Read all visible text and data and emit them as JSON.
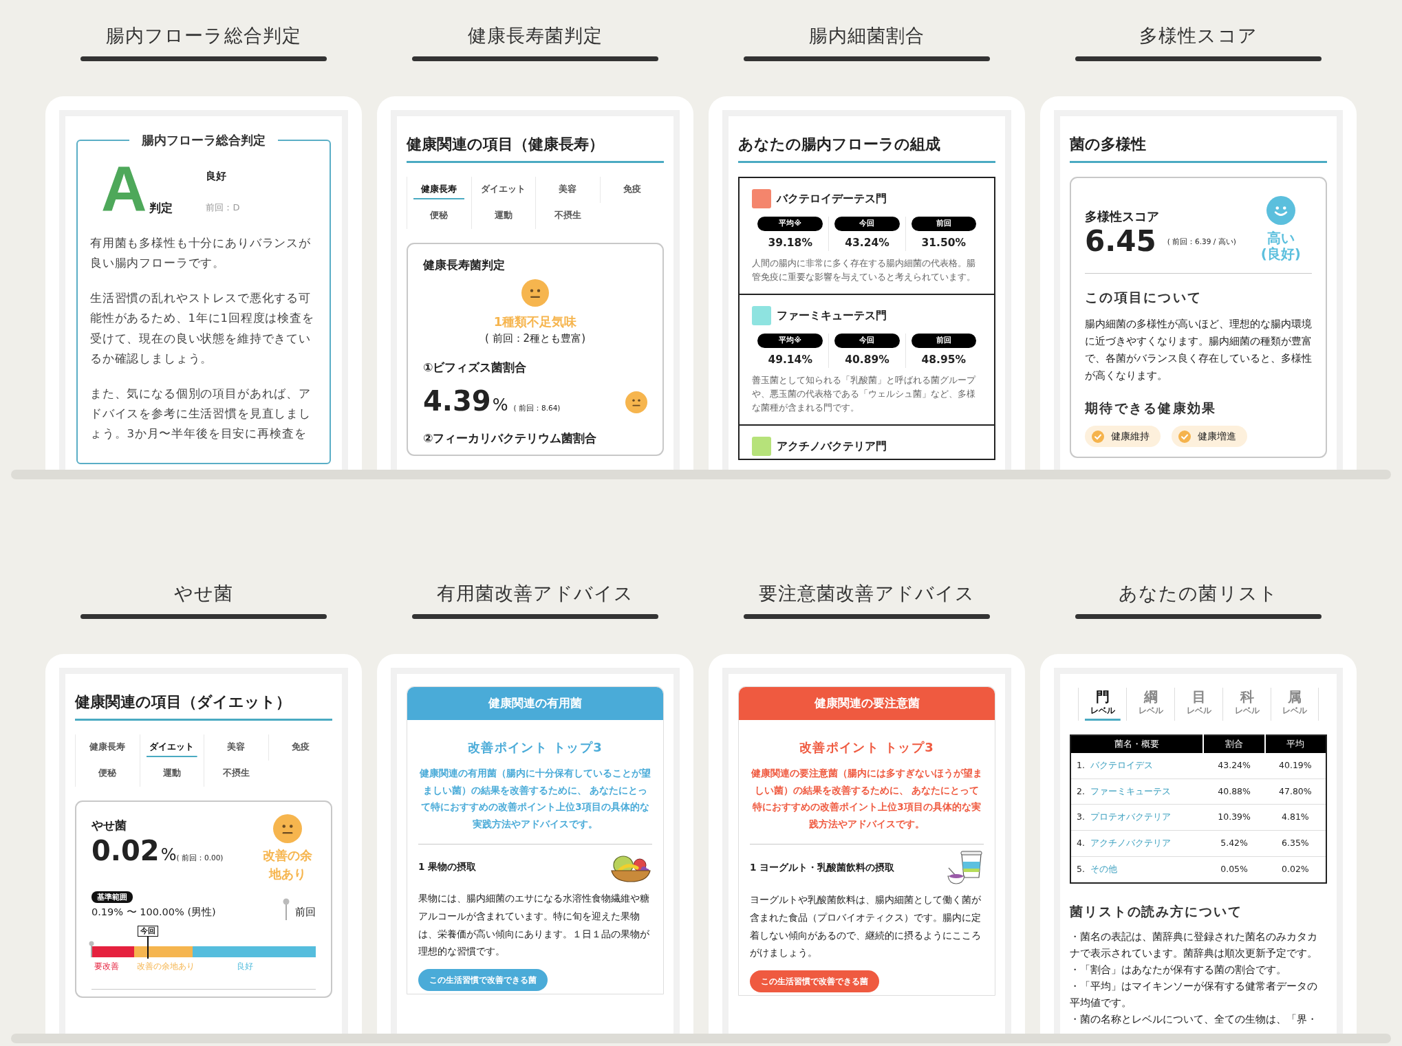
{
  "rows": [
    {
      "panels": [
        {
          "heading": "腸内フローラ総合判定",
          "card": {
            "kind": "overall",
            "title": "腸内フローラ総合判定",
            "grade": "A",
            "grade_label": "判定",
            "result": "良好",
            "previous": "前回：D",
            "paragraphs": [
              "有用菌も多様性も十分にありバランスが良い腸内フローラです。",
              "生活習慣の乱れやストレスで悪化する可能性があるため、1年に1回程度は検査を受けて、現在の良い状態を維持できているか確認しましょう。",
              "また、気になる個別の項目があれば、アドバイスを参考に生活習慣を見直しましょう。3か月〜半年後を目安に再検査を"
            ]
          }
        },
        {
          "heading": "健康長寿菌判定",
          "card": {
            "kind": "category",
            "title": "健康関連の項目（健康長寿）",
            "tabs": [
              {
                "label": "健康長寿",
                "selected": true
              },
              {
                "label": "ダイエット",
                "selected": false
              },
              {
                "label": "美容",
                "selected": false
              },
              {
                "label": "免疫",
                "selected": false
              },
              {
                "label": "便秘",
                "selected": false
              },
              {
                "label": "運動",
                "selected": false
              },
              {
                "label": "不摂生",
                "selected": false
              }
            ],
            "panel": {
              "kind": "verdict",
              "title": "健康長寿菌判定",
              "face": {
                "kind": "neutral",
                "color": "#f6b54e"
              },
              "verdict": "1種類不足気味",
              "previous": "( 前回：2種とも豊富)",
              "items": [
                {
                  "label": "①ビフィズス菌割合",
                  "value": "4.39",
                  "unit": "%",
                  "previous": "( 前回：8.64)",
                  "face": {
                    "kind": "neutral",
                    "color": "#f6b54e"
                  }
                },
                {
                  "label": "②フィーカリバクテリウム菌割合"
                }
              ]
            }
          }
        },
        {
          "heading": "腸内細菌割合",
          "card": {
            "kind": "composition",
            "title": "あなたの腸内フローラの組成",
            "phyla": [
              {
                "name": "バクテロイデーテス門",
                "color": "#f4856c",
                "stats": [
                  {
                    "label": "平均※",
                    "value": "39.18%"
                  },
                  {
                    "label": "今回",
                    "value": "43.24%"
                  },
                  {
                    "label": "前回",
                    "value": "31.50%"
                  }
                ],
                "description": "人間の腸内に非常に多く存在する腸内細菌の代表格。腸管免疫に重要な影響を与えていると考えられています。"
              },
              {
                "name": "ファーミキューテス門",
                "color": "#8ee3e0",
                "stats": [
                  {
                    "label": "平均※",
                    "value": "49.14%"
                  },
                  {
                    "label": "今回",
                    "value": "40.89%"
                  },
                  {
                    "label": "前回",
                    "value": "48.95%"
                  }
                ],
                "description": "善玉菌として知られる「乳酸菌」と呼ばれる菌グループや、悪玉菌の代表格である「ウェルシュ菌」など、多様な菌種が含まれる門です。"
              },
              {
                "name": "アクチノバクテリア門",
                "color": "#b6e27a"
              }
            ]
          }
        },
        {
          "heading": "多様性スコア",
          "card": {
            "kind": "diversity",
            "title": "菌の多様性",
            "score_label": "多様性スコア",
            "score": "6.45",
            "previous": "( 前回：6.39 / 高い)",
            "face": {
              "kind": "happy",
              "color": "#5bbfdd"
            },
            "verdict_lines": [
              "高い",
              "(良好)"
            ],
            "about_title": "この項目について",
            "about": "腸内細菌の多様性が高いほど、理想的な腸内環境に近づきやすくなります。腸内細菌の種類が豊富で、各菌がバランス良く存在していると、多様性が高くなります。",
            "effects_title": "期待できる健康効果",
            "effects": [
              "健康維持",
              "健康増進"
            ]
          }
        }
      ]
    },
    {
      "panels": [
        {
          "heading": "やせ菌",
          "card": {
            "kind": "category",
            "title": "健康関連の項目（ダイエット）",
            "tabs": [
              {
                "label": "健康長寿",
                "selected": false
              },
              {
                "label": "ダイエット",
                "selected": true
              },
              {
                "label": "美容",
                "selected": false
              },
              {
                "label": "免疫",
                "selected": false
              },
              {
                "label": "便秘",
                "selected": false
              },
              {
                "label": "運動",
                "selected": false
              },
              {
                "label": "不摂生",
                "selected": false
              }
            ],
            "panel": {
              "kind": "meter",
              "name": "やせ菌",
              "value": "0.02",
              "unit": "%",
              "previous": "( 前回：0.00)",
              "face": {
                "kind": "neutral",
                "color": "#f6b54e"
              },
              "verdict": "改善の余地あり",
              "range_label": "基準範囲",
              "range": "0.19% 〜 100.00% (男性)",
              "legend": "前回",
              "current": {
                "label": "今回",
                "level": 0.25
              },
              "previous_marker": {
                "level": 0
              },
              "segments": [
                {
                  "label": "要改善",
                  "color": "#e5213e"
                },
                {
                  "label": "改善の余地あり",
                  "color": "#f5b54f"
                },
                {
                  "label": "良好",
                  "color": "#55bddd"
                }
              ]
            }
          }
        },
        {
          "heading": "有用菌改善アドバイス",
          "card": {
            "kind": "advice",
            "color": "#4aabd8",
            "header": "健康関連の有用菌",
            "subtitle": "改善ポイント トップ3",
            "intro": "健康関連の有用菌（腸内に十分保有していることが望ましい菌）の結果を改善するために、 あなたにとって特におすすめの改善ポイント上位3項目の具体的な実践方法やアドバイスです。",
            "items": [
              {
                "title": "1 果物の摂取",
                "kind": "fruit",
                "text": "果物には、腸内細菌のエサになる水溶性食物繊維や糖アルコールが含まれています。特に旬を迎えた果物は、栄養価が高い傾向にあります。１日１品の果物が理想的な習慣です。",
                "button": "この生活習慣で改善できる菌"
              }
            ]
          }
        },
        {
          "heading": "要注意菌改善アドバイス",
          "card": {
            "kind": "advice",
            "color": "#ef5a40",
            "header": "健康関連の要注意菌",
            "subtitle": "改善ポイント トップ3",
            "intro": "健康関連の要注意菌（腸内には多すぎないほうが望ましい菌）の結果を改善するために、 あなたにとって特におすすめの改善ポイント上位3項目の具体的な実践方法やアドバイスです。",
            "items": [
              {
                "title": "1 ヨーグルト・乳酸菌飲料の摂取",
                "kind": "yogurt",
                "text": "ヨーグルトや乳酸菌飲料は、腸内細菌として働く菌が含まれた食品（プロバイオティクス）です。腸内に定着しない傾向があるので、継続的に摂るようにこころがけましょう。",
                "button": "この生活習慣で改善できる菌"
              }
            ]
          }
        },
        {
          "heading": "あなたの菌リスト",
          "card": {
            "kind": "list",
            "level_tabs": [
              {
                "label": "門",
                "sub": "レベル",
                "selected": true
              },
              {
                "label": "綱",
                "sub": "レベル",
                "selected": false
              },
              {
                "label": "目",
                "sub": "レベル",
                "selected": false
              },
              {
                "label": "科",
                "sub": "レベル",
                "selected": false
              },
              {
                "label": "属",
                "sub": "レベル",
                "selected": false
              }
            ],
            "table": {
              "columns": [
                "菌名・概要",
                "割合",
                "平均"
              ],
              "rows": [
                {
                  "rank": "1.",
                  "name": "バクテロイデス",
                  "ratio": "43.24%",
                  "average": "40.19%"
                },
                {
                  "rank": "2.",
                  "name": "ファーミキューテス",
                  "ratio": "40.88%",
                  "average": "47.80%"
                },
                {
                  "rank": "3.",
                  "name": "プロテオバクテリア",
                  "ratio": "10.39%",
                  "average": "4.81%"
                },
                {
                  "rank": "4.",
                  "name": "アクチノバクテリア",
                  "ratio": "5.42%",
                  "average": "6.35%"
                },
                {
                  "rank": "5.",
                  "name": "その他",
                  "ratio": "0.05%",
                  "average": "0.02%"
                }
              ]
            },
            "notes_title": "菌リストの読み方について",
            "notes": [
              "・菌名の表記は、菌辞典に登録された菌名のみカタカナで表示されています。菌辞典は順次更新予定です。",
              "・「割合」はあなたが保有する菌の割合です。",
              "・「平均」はマイキンソーが保有する健常者データの平均値です。",
              "・菌の名称とレベルについて、全ての生物は、「界・"
            ]
          }
        }
      ]
    }
  ]
}
